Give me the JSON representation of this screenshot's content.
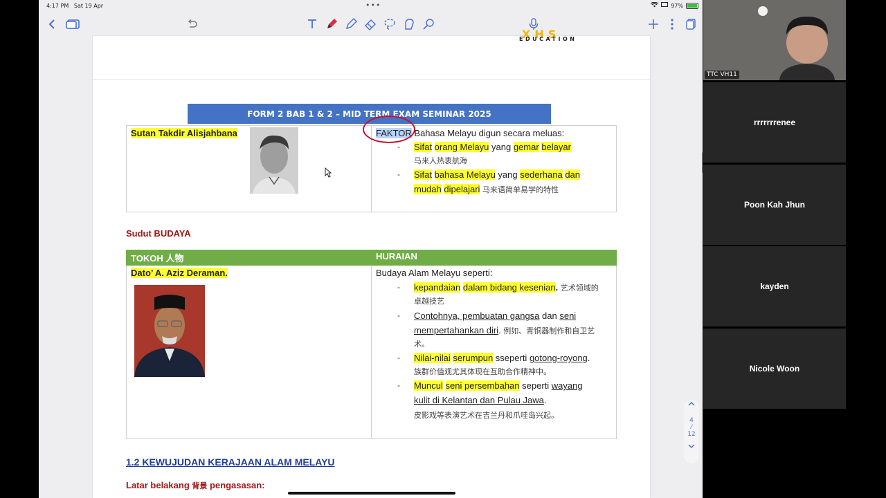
{
  "statusbar": {
    "time": "4:17 PM",
    "date": "Sat 19 Apr",
    "battery": "97%",
    "dots": "•••"
  },
  "toolbar": {
    "back_icon": "chevron-left-icon",
    "thumbnails_icon": "thumbnails-icon",
    "undo_icon": "undo-icon",
    "tools": [
      "text-tool-icon",
      "pen-tool-icon",
      "highlighter-tool-icon",
      "eraser-tool-icon",
      "lasso-tool-icon",
      "shape-tool-icon",
      "link-tool-icon"
    ],
    "mic_icon": "microphone-icon",
    "add_icon": "plus-icon",
    "more_icon": "more-icon",
    "pages_icon": "pages-icon"
  },
  "logo": {
    "mark": "XHS",
    "text": "EDUCATION"
  },
  "document": {
    "title": "FORM 2 BAB 1 & 2 – MID TERM EXAM SEMINAR 2025",
    "table1": {
      "name": "Sutan Takdir Alisjahbana",
      "faktor_word": "FAKTOR",
      "intro_rest": " Bahasa Melayu digun secara meluas:",
      "item1": {
        "w1": "Sifat",
        "w2": "orang Melayu",
        "w3": " yang ",
        "w4": "gemar",
        "w5": " ",
        "w6": "belayar",
        "cn": "马来人热衷航海"
      },
      "item2": {
        "w1": "Sifat",
        "w2": "bahasa Melayu",
        "w3": " yang ",
        "w4": "sederhana",
        "w5": "dan",
        "w6": "mudah",
        "w7": "dipelajari",
        "cn": "马来语简单易学的特性"
      }
    },
    "budaya_heading": "Sudut BUDAYA",
    "table2": {
      "header_left": "TOKOH 人物",
      "header_right": "HURAIAN",
      "name": "Dato’ A. Aziz Deraman.",
      "intro": "Budaya Alam Melayu seperti:",
      "item1": {
        "w1": "kepandaian",
        "w2": "dalam bidang kesenian",
        "w3": ".",
        "cn1": " 艺术领域的",
        "cn2": "卓越技艺"
      },
      "item2": {
        "u1": "Contohnya, pembuatan gangsa",
        "t1": " dan ",
        "u2": "seni",
        "u3": "mempertahankan diri",
        "t2": ".",
        "cn1": " 例如、青铜器制作和自卫艺",
        "cn2": "术。"
      },
      "item3": {
        "w1": "Nilai-nilai",
        "w2": "serumpun",
        "t1": " sseperti ",
        "u1": "gotong-royong",
        "t2": ".",
        "cn": "族群价值观尤其体现在互助合作精神中。"
      },
      "item4": {
        "w1": "Muncul",
        "w2": "seni persembahan",
        "t1": " seperti ",
        "u1": "wayang",
        "u2": "kulit di Kelantan dan Pulau Jawa",
        "t2": ".",
        "cn": "皮影戏等表演艺术在吉兰丹和爪哇岛兴起。"
      }
    },
    "section_heading": "1.2 KEWUJUDAN KERAJAAN ALAM MELAYU",
    "latar": {
      "w1": "Latar belakang ",
      "cn": "背景",
      "w2": " pengasasan:"
    }
  },
  "page_indicator": {
    "current": "4",
    "sep": "⁄",
    "total": "12"
  },
  "participants": {
    "video_name": "TTC VH11",
    "names": [
      "rrrrrrrenee",
      "Poon Kah Jhun",
      "kayden",
      "Nicole Woon"
    ]
  }
}
